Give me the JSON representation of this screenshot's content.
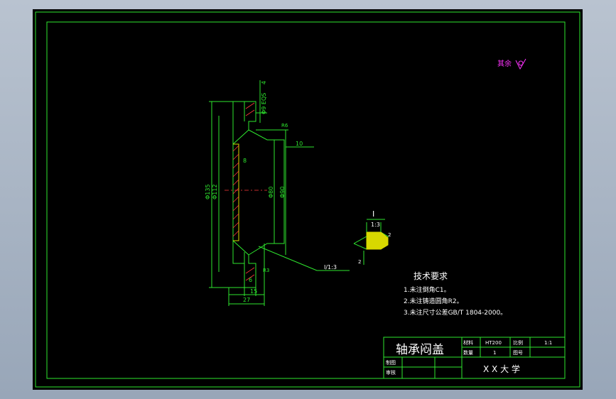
{
  "drawing": {
    "roughness_note": "其余",
    "dimensions": {
      "d_flange_top": "4",
      "d_phi_e09": "Φ9 EQS",
      "d_phi135": "Φ135",
      "d_phi112": "Φ112",
      "d_phi80": "Φ80",
      "d_phi90": "Φ90",
      "d_8": "8",
      "d_10": "10",
      "d_6": "6",
      "d_15": "15",
      "d_27": "27",
      "d_r6": "R6",
      "d_r3": "R3"
    },
    "detail_callout": "I/1:3",
    "detail_label": "I",
    "detail_scale": "1:3",
    "detail_dim_2a": "2",
    "detail_dim_2b": "2",
    "tech_title": "技术要求",
    "tech_items": [
      "1.未注倒角C1。",
      "2.未注铸造圆角R2。",
      "3.未注尺寸公差GB/T 1804-2000。"
    ]
  },
  "title_block": {
    "part_name": "轴承闷盖",
    "material_label": "材料",
    "material": "HT200",
    "scale_label": "比例",
    "scale": "1:1",
    "qty_label": "数量",
    "qty": "1",
    "drawing_no_label": "图号",
    "drawer_label": "制图",
    "reviewer_label": "审核",
    "school": "X X 大 学"
  },
  "colors": {
    "line": "#2ee62e",
    "text": "#ffffff",
    "accent": "#ff33ff",
    "hatch": "#ff3b3b"
  }
}
